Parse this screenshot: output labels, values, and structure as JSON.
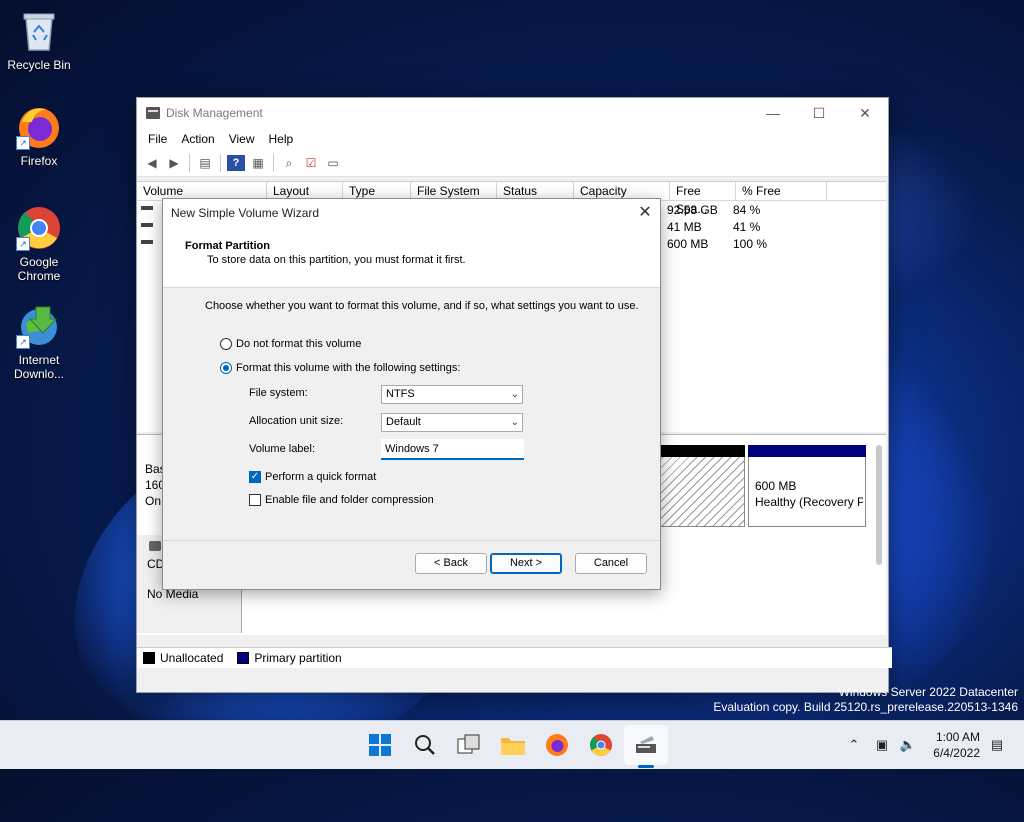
{
  "desktop": {
    "icons": [
      {
        "label": "Recycle Bin"
      },
      {
        "label": "Firefox"
      },
      {
        "label": "Google Chrome"
      },
      {
        "label": "Internet Downlo..."
      }
    ],
    "watermark": {
      "line1": "Windows Server 2022 Datacenter",
      "line2": "Evaluation copy. Build 25120.rs_prerelease.220513-1346"
    }
  },
  "disk_management": {
    "title": "Disk Management",
    "window_controls": {
      "minimize": "—",
      "maximize": "☐",
      "close": "✕"
    },
    "menu": [
      "File",
      "Action",
      "View",
      "Help"
    ],
    "columns": [
      "Volume",
      "Layout",
      "Type",
      "File System",
      "Status",
      "Capacity",
      "Free Spa...",
      "% Free"
    ],
    "rows": [
      {
        "free_space": "92.58 GB",
        "pct_free": "84 %"
      },
      {
        "free_space": "41 MB",
        "pct_free": "41 %"
      },
      {
        "free_space": "600 MB",
        "pct_free": "100 %"
      }
    ],
    "graph": {
      "disk0_lines": [
        "Bas",
        "160",
        "On"
      ],
      "primary_partition": {
        "size": "600 MB",
        "status": "Healthy (Recovery P"
      },
      "cd_label": "CD",
      "cd_status": "No Media"
    },
    "legend": {
      "unallocated": "Unallocated",
      "primary": "Primary partition"
    },
    "colors": {
      "unallocated": "#000000",
      "primary": "#00007f"
    }
  },
  "wizard": {
    "title": "New Simple Volume Wizard",
    "close": "✕",
    "header_title": "Format Partition",
    "header_subtitle": "To store data on this partition, you must format it first.",
    "intro": "Choose whether you want to format this volume, and if so, what settings you want to use.",
    "option_no_format": "Do not format this volume",
    "option_format": "Format this volume with the following settings:",
    "selected_option": "format",
    "file_system_label": "File system:",
    "file_system_value": "NTFS",
    "alloc_label": "Allocation unit size:",
    "alloc_value": "Default",
    "volume_label_label": "Volume label:",
    "volume_label_value": "Windows 7",
    "quick_format_label": "Perform a quick format",
    "quick_format_checked": true,
    "compression_label": "Enable file and folder compression",
    "compression_checked": false,
    "back_button": "< Back",
    "next_button": "Next >",
    "cancel_button": "Cancel",
    "accent": "#0067c0"
  },
  "taskbar": {
    "time": "1:00 AM",
    "date": "6/4/2022"
  }
}
